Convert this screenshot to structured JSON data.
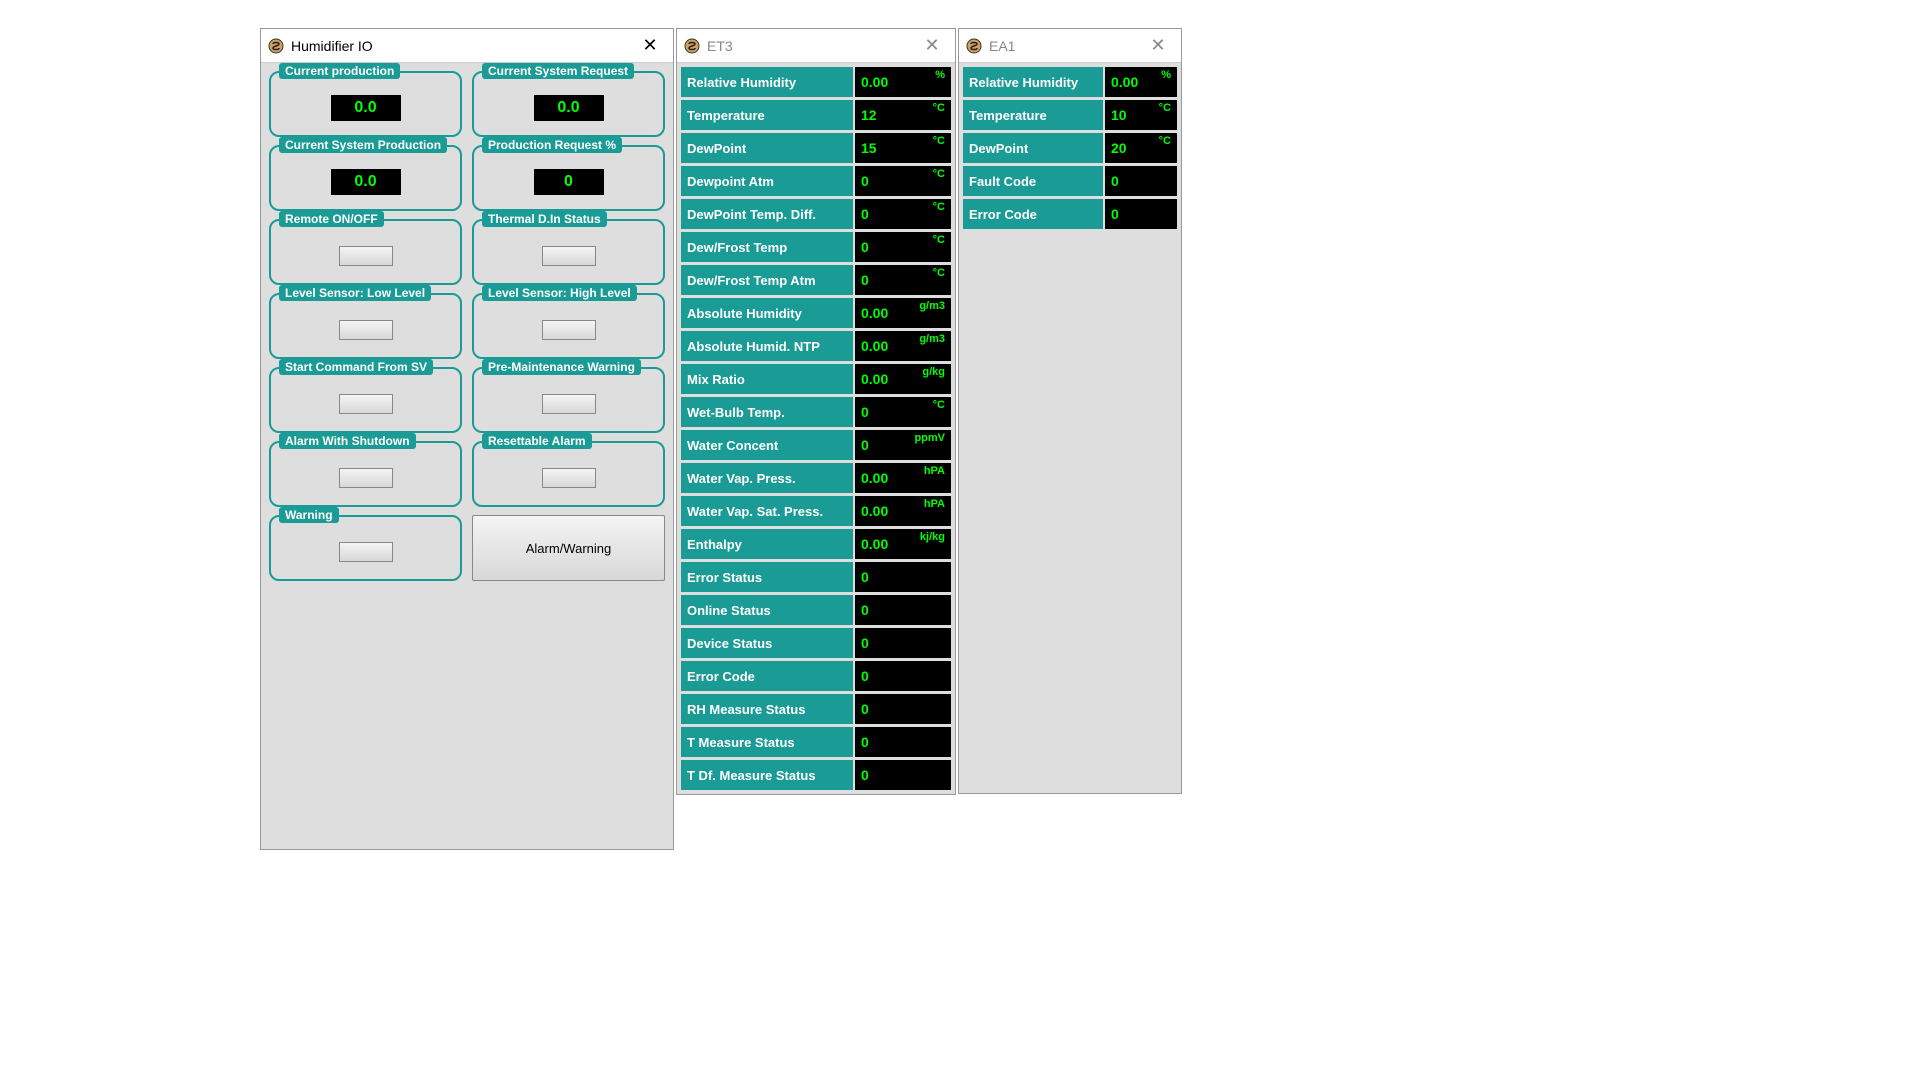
{
  "humidifier": {
    "title": "Humidifier IO",
    "tiles": {
      "current_production": {
        "legend": "Current production",
        "value": "0.0"
      },
      "current_system_request": {
        "legend": "Current System Request",
        "value": "0.0"
      },
      "current_system_production": {
        "legend": "Current System Production",
        "value": "0.0"
      },
      "production_request_pct": {
        "legend": "Production Request %",
        "value": "0"
      },
      "remote_on_off": {
        "legend": "Remote ON/OFF"
      },
      "thermal_din_status": {
        "legend": "Thermal D.In Status"
      },
      "level_sensor_low": {
        "legend": "Level Sensor: Low Level"
      },
      "level_sensor_high": {
        "legend": "Level Sensor: High Level"
      },
      "start_command_from_sv": {
        "legend": "Start Command From SV"
      },
      "pre_maintenance_warning": {
        "legend": "Pre-Maintenance Warning"
      },
      "alarm_with_shutdown": {
        "legend": "Alarm With Shutdown"
      },
      "resettable_alarm": {
        "legend": "Resettable Alarm"
      },
      "warning": {
        "legend": "Warning"
      }
    },
    "alarm_warning_button": "Alarm/Warning"
  },
  "et3": {
    "title": "ET3",
    "rows": [
      {
        "label": "Relative Humidity",
        "value": "0.00",
        "unit": "%"
      },
      {
        "label": "Temperature",
        "value": "12",
        "unit": "°C"
      },
      {
        "label": "DewPoint",
        "value": "15",
        "unit": "°C"
      },
      {
        "label": "Dewpoint Atm",
        "value": "0",
        "unit": "°C"
      },
      {
        "label": "DewPoint Temp. Diff.",
        "value": "0",
        "unit": "°C"
      },
      {
        "label": "Dew/Frost Temp",
        "value": "0",
        "unit": "°C"
      },
      {
        "label": "Dew/Frost Temp Atm",
        "value": "0",
        "unit": "°C"
      },
      {
        "label": "Absolute Humidity",
        "value": "0.00",
        "unit": "g/m3"
      },
      {
        "label": "Absolute Humid. NTP",
        "value": "0.00",
        "unit": "g/m3"
      },
      {
        "label": "Mix Ratio",
        "value": "0.00",
        "unit": "g/kg"
      },
      {
        "label": "Wet-Bulb Temp.",
        "value": "0",
        "unit": "°C"
      },
      {
        "label": "Water Concent",
        "value": "0",
        "unit": "ppmV"
      },
      {
        "label": "Water Vap. Press.",
        "value": "0.00",
        "unit": "hPA"
      },
      {
        "label": "Water Vap. Sat. Press.",
        "value": "0.00",
        "unit": "hPA"
      },
      {
        "label": "Enthalpy",
        "value": "0.00",
        "unit": "kj/kg"
      },
      {
        "label": "Error Status",
        "value": "0",
        "unit": ""
      },
      {
        "label": "Online Status",
        "value": "0",
        "unit": ""
      },
      {
        "label": "Device Status",
        "value": "0",
        "unit": ""
      },
      {
        "label": "Error Code",
        "value": "0",
        "unit": ""
      },
      {
        "label": "RH Measure Status",
        "value": "0",
        "unit": ""
      },
      {
        "label": "T Measure Status",
        "value": "0",
        "unit": ""
      },
      {
        "label": "T Df. Measure Status",
        "value": "0",
        "unit": ""
      }
    ]
  },
  "ea1": {
    "title": "EA1",
    "rows": [
      {
        "label": "Relative Humidity",
        "value": "0.00",
        "unit": "%"
      },
      {
        "label": "Temperature",
        "value": "10",
        "unit": "°C"
      },
      {
        "label": "DewPoint",
        "value": "20",
        "unit": "°C"
      },
      {
        "label": "Fault Code",
        "value": "0",
        "unit": ""
      },
      {
        "label": "Error Code",
        "value": "0",
        "unit": ""
      }
    ]
  }
}
